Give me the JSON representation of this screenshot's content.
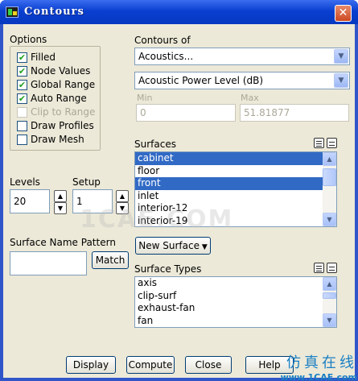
{
  "window": {
    "title": "Contours",
    "close_glyph": "✕"
  },
  "options": {
    "label": "Options",
    "items": [
      {
        "label": "Filled",
        "checked": true,
        "enabled": true
      },
      {
        "label": "Node Values",
        "checked": true,
        "enabled": true
      },
      {
        "label": "Global Range",
        "checked": true,
        "enabled": true
      },
      {
        "label": "Auto Range",
        "checked": true,
        "enabled": true
      },
      {
        "label": "Clip to Range",
        "checked": false,
        "enabled": false
      },
      {
        "label": "Draw Profiles",
        "checked": false,
        "enabled": true
      },
      {
        "label": "Draw Mesh",
        "checked": false,
        "enabled": true
      }
    ]
  },
  "contours_of": {
    "label": "Contours of",
    "category": "Acoustics...",
    "quantity": "Acoustic Power Level (dB)",
    "min_label": "Min",
    "min_value": "0",
    "max_label": "Max",
    "max_value": "51.81877"
  },
  "levels": {
    "label": "Levels",
    "value": "20"
  },
  "setup": {
    "label": "Setup",
    "value": "1"
  },
  "surfaces": {
    "label": "Surfaces",
    "items": [
      {
        "label": "cabinet",
        "selected": true
      },
      {
        "label": "floor",
        "selected": false
      },
      {
        "label": "front",
        "selected": true
      },
      {
        "label": "inlet",
        "selected": false
      },
      {
        "label": "interior-12",
        "selected": false
      },
      {
        "label": "interior-19",
        "selected": false
      }
    ]
  },
  "surface_name_pattern": {
    "label": "Surface Name Pattern",
    "value": "",
    "match_label": "Match"
  },
  "new_surface": {
    "label": "New Surface"
  },
  "surface_types": {
    "label": "Surface Types",
    "items": [
      "axis",
      "clip-surf",
      "exhaust-fan",
      "fan"
    ]
  },
  "buttons": {
    "display": "Display",
    "compute": "Compute",
    "close": "Close",
    "help": "Help"
  },
  "watermark": "1CAE.COM",
  "brand": {
    "cn": "仿真在线",
    "url": "www.1CAE.com"
  }
}
